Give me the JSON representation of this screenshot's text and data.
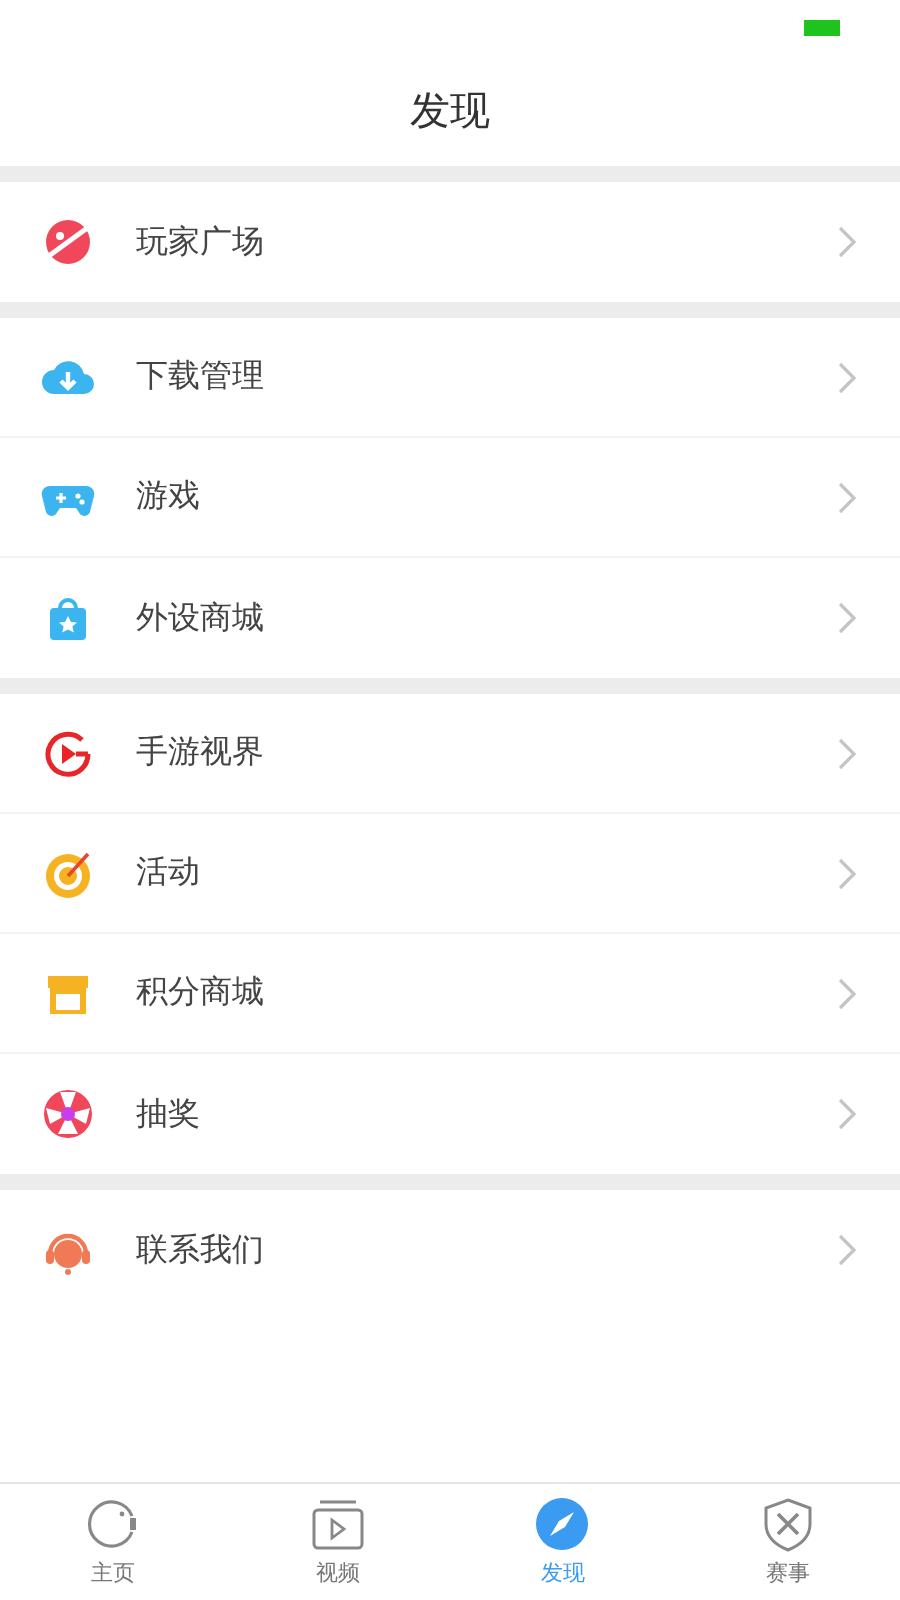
{
  "header": {
    "title": "发现"
  },
  "groups": [
    {
      "items": [
        {
          "label": "玩家广场",
          "kind": "planet"
        }
      ]
    },
    {
      "items": [
        {
          "label": "下载管理",
          "kind": "cloud"
        },
        {
          "label": "游戏",
          "kind": "gamepad"
        },
        {
          "label": "外设商城",
          "kind": "bag"
        }
      ]
    },
    {
      "items": [
        {
          "label": "手游视界",
          "kind": "play"
        },
        {
          "label": "活动",
          "kind": "target"
        },
        {
          "label": "积分商城",
          "kind": "shop"
        },
        {
          "label": "抽奖",
          "kind": "wheel"
        }
      ]
    },
    {
      "items": [
        {
          "label": "联系我们",
          "kind": "headset"
        }
      ]
    }
  ],
  "tabs": [
    {
      "label": "主页",
      "kind": "home",
      "selected": false
    },
    {
      "label": "视频",
      "kind": "video",
      "selected": false
    },
    {
      "label": "发现",
      "kind": "compass",
      "selected": true
    },
    {
      "label": "赛事",
      "kind": "shield",
      "selected": false
    }
  ]
}
